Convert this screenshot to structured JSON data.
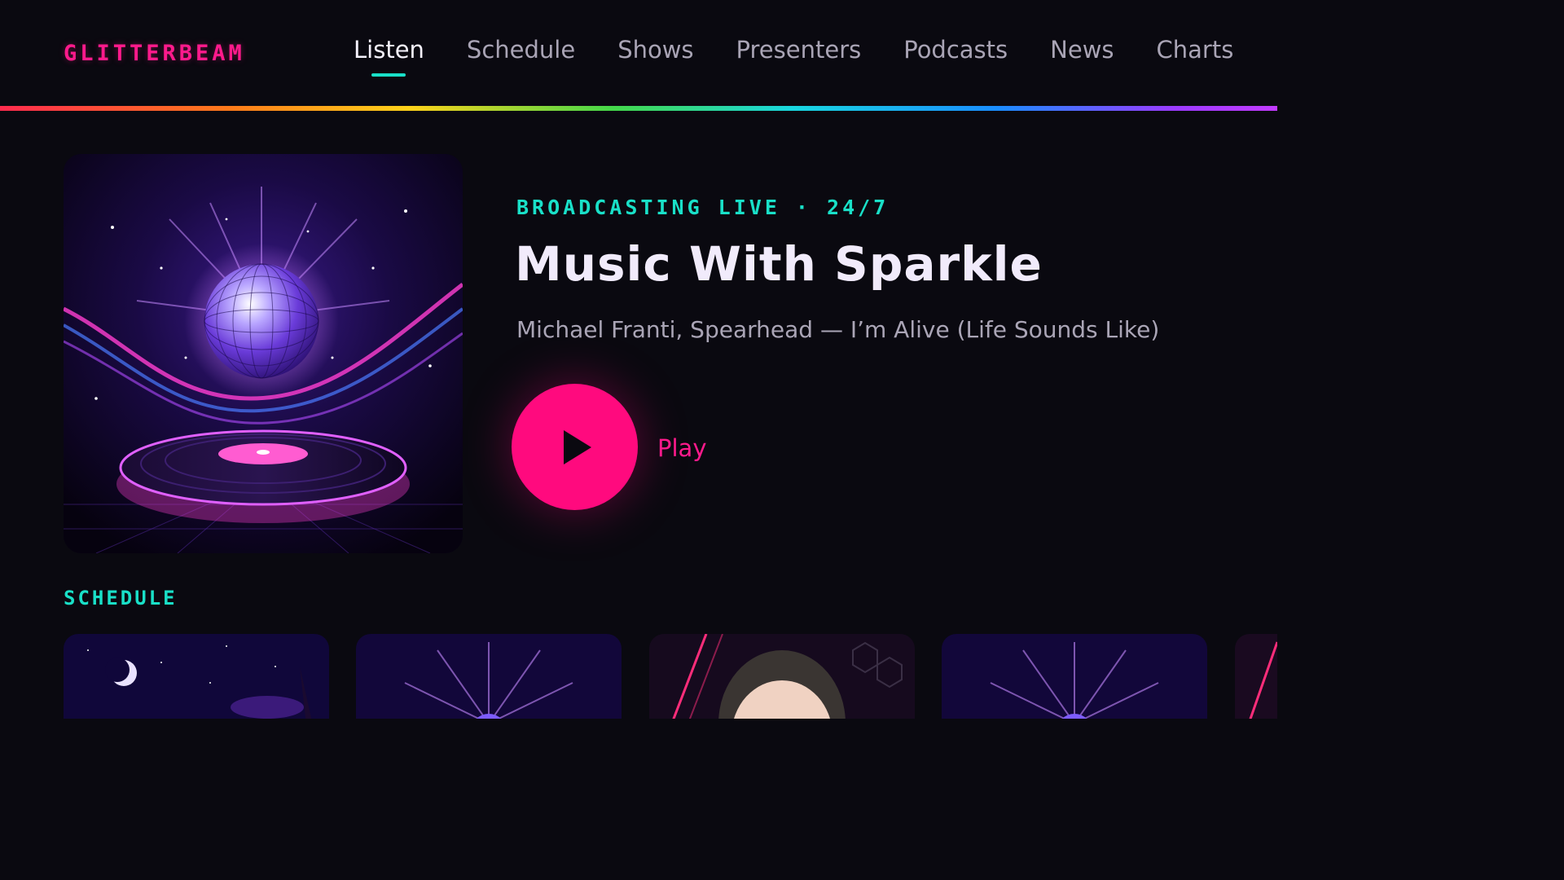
{
  "brand": {
    "logo": "GLITTERBEAM"
  },
  "nav": {
    "items": [
      {
        "label": "Listen",
        "active": true
      },
      {
        "label": "Schedule",
        "active": false
      },
      {
        "label": "Shows",
        "active": false
      },
      {
        "label": "Presenters",
        "active": false
      },
      {
        "label": "Podcasts",
        "active": false
      },
      {
        "label": "News",
        "active": false
      },
      {
        "label": "Charts",
        "active": false
      }
    ]
  },
  "hero": {
    "status": "BROADCASTING LIVE · 24/7",
    "show_title": "Music With Sparkle",
    "now_playing": "Michael Franti, Spearhead — I’m Alive (Life Sounds Like)",
    "play_label": "Play"
  },
  "schedule": {
    "heading": "SCHEDULE",
    "cards": [
      {
        "image": "night-sky-moon"
      },
      {
        "image": "disco-ball"
      },
      {
        "image": "presenter-portrait"
      },
      {
        "image": "disco-ball"
      },
      {
        "image": "neon-lines"
      }
    ]
  },
  "colors": {
    "background": "#0a0910",
    "accent_pink": "#ff0a7e",
    "accent_teal": "#19e0c8",
    "text_primary": "#f1ebfb",
    "text_secondary": "#aaa5b6"
  }
}
